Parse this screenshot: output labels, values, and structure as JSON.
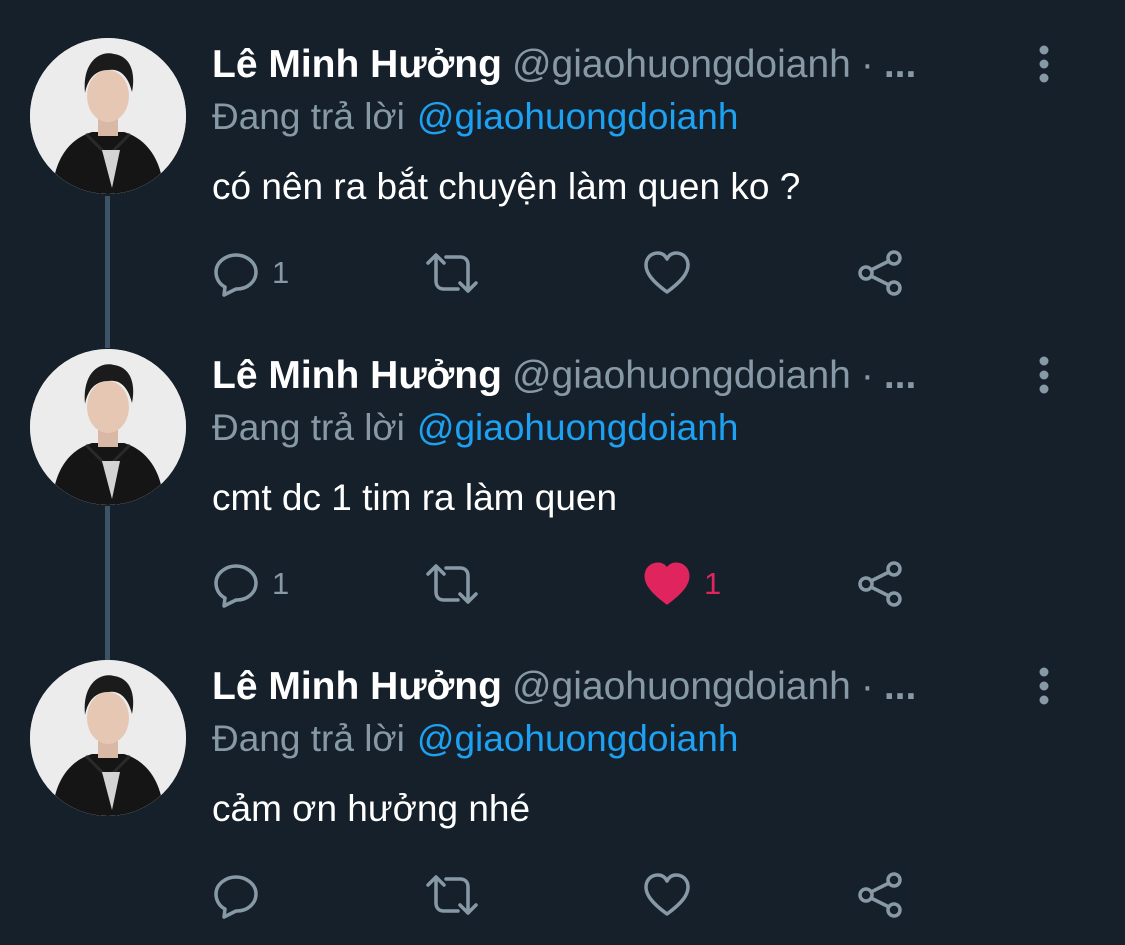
{
  "colors": {
    "background": "#15202b",
    "secondary_text": "#8899a6",
    "mention": "#1da1f2",
    "like_active": "#e0245e",
    "thread_line": "#3d5466"
  },
  "tweets": [
    {
      "author_name": "Lê Minh Hưởng",
      "handle": "@giaohuongdoianh",
      "separator": "·",
      "ellipsis": "...",
      "reply_prefix": "Đang trả lời",
      "reply_to": "@giaohuongdoianh",
      "text": "có nên ra bắt chuyện làm quen ko ?",
      "reply_count": "1",
      "retweet_count": "",
      "like_count": "",
      "liked": false,
      "icons": [
        "avatar-photo",
        "more-vertical-icon",
        "reply-icon",
        "retweet-icon",
        "heart-outline-icon",
        "share-icon"
      ]
    },
    {
      "author_name": "Lê Minh Hưởng",
      "handle": "@giaohuongdoianh",
      "separator": "·",
      "ellipsis": "...",
      "reply_prefix": "Đang trả lời",
      "reply_to": "@giaohuongdoianh",
      "text": "cmt dc 1 tim ra làm quen",
      "reply_count": "1",
      "retweet_count": "",
      "like_count": "1",
      "liked": true,
      "icons": [
        "avatar-photo",
        "more-vertical-icon",
        "reply-icon",
        "retweet-icon",
        "heart-filled-icon",
        "share-icon"
      ]
    },
    {
      "author_name": "Lê Minh Hưởng",
      "handle": "@giaohuongdoianh",
      "separator": "·",
      "ellipsis": "...",
      "reply_prefix": "Đang trả lời",
      "reply_to": "@giaohuongdoianh",
      "text": "cảm ơn hưởng nhé",
      "reply_count": "",
      "retweet_count": "",
      "like_count": "",
      "liked": false,
      "icons": [
        "avatar-photo",
        "more-vertical-icon",
        "reply-icon",
        "retweet-icon",
        "heart-outline-icon",
        "share-icon"
      ]
    }
  ]
}
